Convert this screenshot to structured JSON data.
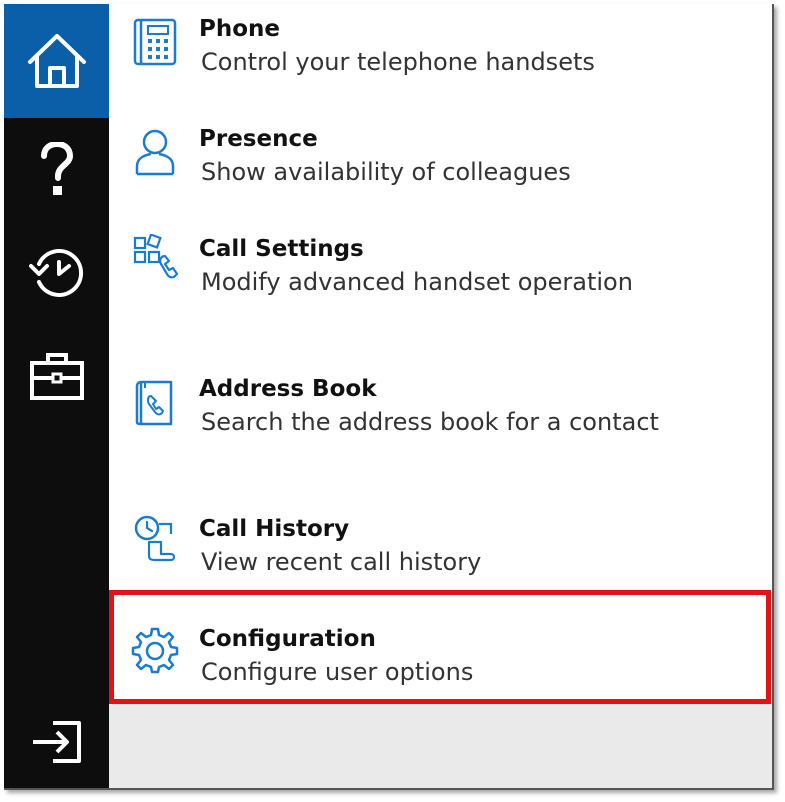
{
  "sidebar": {
    "items": [
      {
        "name": "home",
        "icon": "home-icon",
        "active": true
      },
      {
        "name": "help",
        "icon": "question-icon",
        "active": false
      },
      {
        "name": "history",
        "icon": "clock-history-icon",
        "active": false
      },
      {
        "name": "tools",
        "icon": "briefcase-icon",
        "active": false
      },
      {
        "name": "exit",
        "icon": "sign-in-icon",
        "active": false
      }
    ],
    "background": "#0d0d0d",
    "active_color": "#0b5fa8"
  },
  "menu": {
    "items": [
      {
        "title": "Phone",
        "description": "Control your telephone handsets",
        "icon": "phone-keypad-icon"
      },
      {
        "title": "Presence",
        "description": "Show availability of colleagues",
        "icon": "person-icon"
      },
      {
        "title": "Call Settings",
        "description": "Modify advanced handset operation",
        "icon": "call-settings-icon"
      },
      {
        "title": "Address Book",
        "description": "Search the address book for a contact",
        "icon": "address-book-icon"
      },
      {
        "title": "Call History",
        "description": "View recent call history",
        "icon": "call-history-icon"
      },
      {
        "title": "Configuration",
        "description": "Configure user options",
        "icon": "gear-icon"
      }
    ],
    "icon_color": "#1a7cd1",
    "highlighted_item": "Configuration",
    "highlight_color": "#e11218"
  }
}
